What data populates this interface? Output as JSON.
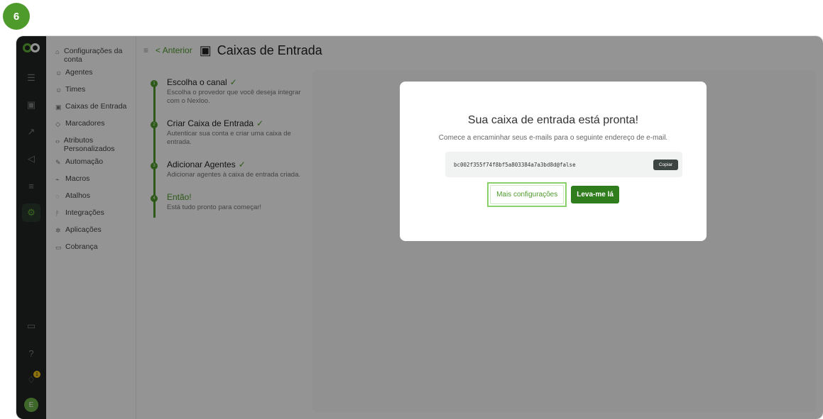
{
  "step_number": "6",
  "rail": {
    "notification_count": "1",
    "avatar_initial": "E"
  },
  "sidebar": {
    "items": [
      {
        "label": "Configurações da conta"
      },
      {
        "label": "Agentes"
      },
      {
        "label": "Times"
      },
      {
        "label": "Caixas de Entrada"
      },
      {
        "label": "Marcadores"
      },
      {
        "label": "Atributos Personalizados"
      },
      {
        "label": "Automação"
      },
      {
        "label": "Macros"
      },
      {
        "label": "Atalhos"
      },
      {
        "label": "Integrações"
      },
      {
        "label": "Aplicações"
      },
      {
        "label": "Cobrança"
      }
    ]
  },
  "header": {
    "back_label": "< Anterior",
    "title": "Caixas de Entrada"
  },
  "steps": [
    {
      "num": "1",
      "title": "Escolha o canal",
      "desc": "Escolha o provedor que você deseja integrar com o Nexloo."
    },
    {
      "num": "2",
      "title": "Criar Caixa de Entrada",
      "desc": "Autenticar sua conta e criar uma caixa de entrada."
    },
    {
      "num": "3",
      "title": "Adicionar Agentes",
      "desc": "Adicionar agentes à caixa de entrada criada."
    },
    {
      "num": "4",
      "title": "Então!",
      "desc": "Está tudo pronto para começar!"
    }
  ],
  "modal": {
    "title": "Sua caixa de entrada está pronta!",
    "description": "Comece a encaminhar seus e-mails para o seguinte endereço de e-mail.",
    "address": "bc002f355f74f8bf5a803384a7a3bd8d@false",
    "copy_label": "Copiar",
    "more_settings_label": "Mais configurações",
    "take_me_label": "Leva-me lá"
  },
  "colors": {
    "accent": "#4e9a2b",
    "rail_bg": "#1f2523"
  }
}
